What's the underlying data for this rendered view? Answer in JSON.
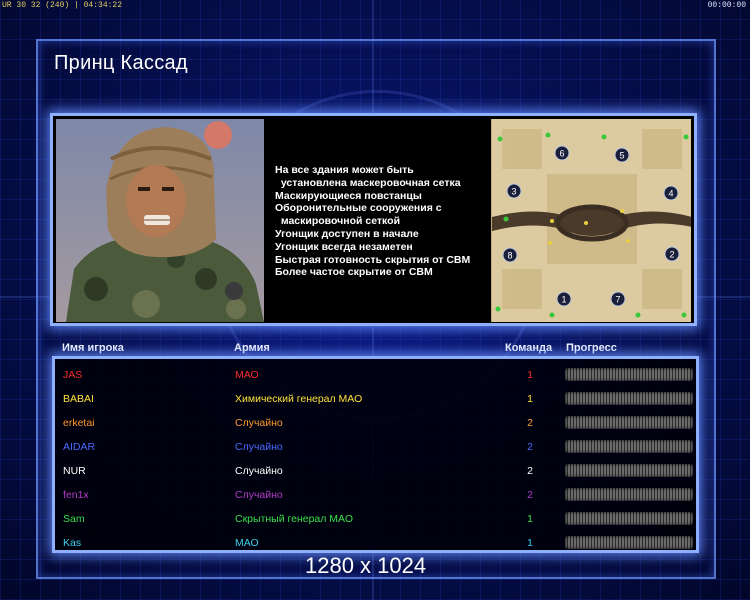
{
  "hud": {
    "left": "UR 30 32 (240) | 04:34:22",
    "right": "00:00:00"
  },
  "title": "Принц Кассад",
  "features": [
    "На все здания может быть",
    "  установлена маскеровочная сетка",
    "Маскирующиеся повстанцы",
    "Оборонительные сооружения с",
    "  маскировочной сеткой",
    "Угонщик доступен в начале",
    "Угонщик всегда незаметен",
    "Быстрая готовность скрытия от СВМ",
    "Более частое скрытие от СВМ"
  ],
  "minimap": {
    "start_positions": [
      "1",
      "2",
      "3",
      "4",
      "5",
      "6",
      "7",
      "8"
    ]
  },
  "table": {
    "headers": {
      "name": "Имя игрока",
      "army": "Армия",
      "team": "Команда",
      "progress": "Прогресс"
    },
    "rows": [
      {
        "name": "JAS",
        "army": "МАО",
        "team": "1",
        "color": "#ff2a2a"
      },
      {
        "name": "BABAI",
        "army": "Химический генерал МАО",
        "team": "1",
        "color": "#ffe23a"
      },
      {
        "name": "erketai",
        "army": "Случайно",
        "team": "2",
        "color": "#ff9a2a"
      },
      {
        "name": "AIDAR",
        "army": "Случайно",
        "team": "2",
        "color": "#4a6aff"
      },
      {
        "name": "NUR",
        "army": "Случайно",
        "team": "2",
        "color": "#ffffff"
      },
      {
        "name": "fen1x",
        "army": "Случайно",
        "team": "2",
        "color": "#b43ac8"
      },
      {
        "name": "Sam",
        "army": "Скрытный генерал МАО",
        "team": "1",
        "color": "#3ae04a"
      },
      {
        "name": "Kas",
        "army": "МАО",
        "team": "1",
        "color": "#3ad0e8"
      }
    ]
  },
  "resolution": "1280 x 1024"
}
